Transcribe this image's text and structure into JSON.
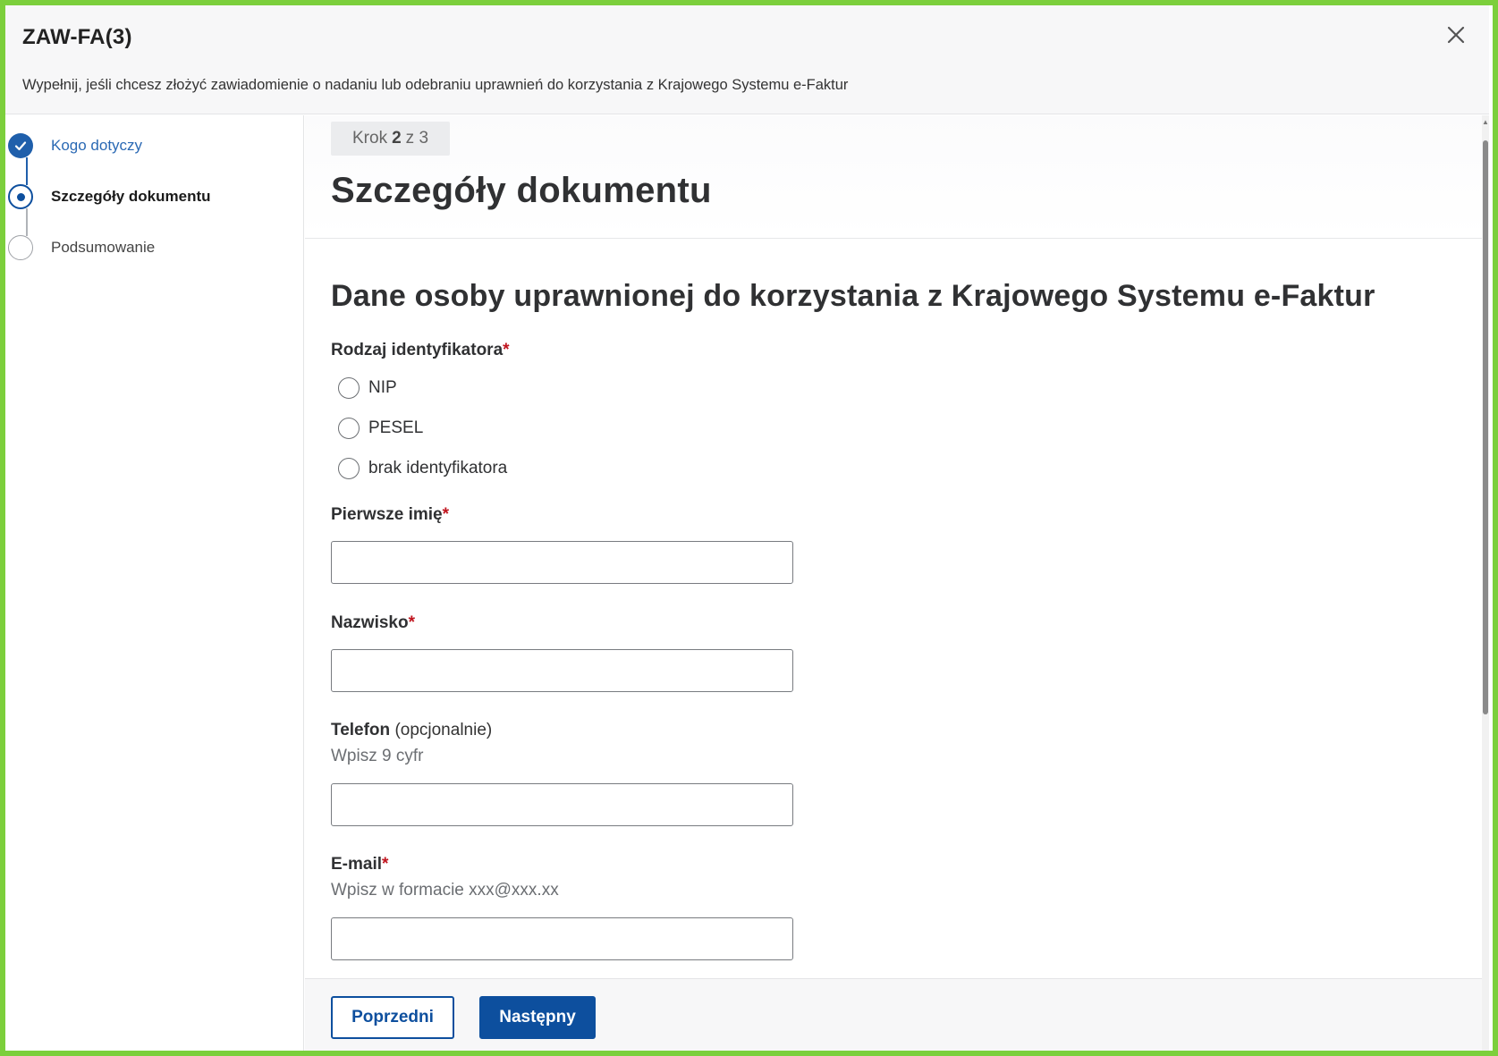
{
  "header": {
    "title": "ZAW-FA(3)",
    "subtitle": "Wypełnij, jeśli chcesz złożyć zawiadomienie o nadaniu lub odebraniu uprawnień do korzystania z Krajowego Systemu e-Faktur",
    "close_icon": "close-icon"
  },
  "steps": [
    {
      "label": "Kogo dotyczy",
      "state": "completed"
    },
    {
      "label": "Szczegóły dokumentu",
      "state": "current"
    },
    {
      "label": "Podsumowanie",
      "state": "pending"
    }
  ],
  "step_indicator": {
    "prefix": "Krok",
    "current": "2",
    "separator": "z",
    "total": "3"
  },
  "page_title": "Szczegóły dokumentu",
  "section_title": "Dane osoby uprawnionej do korzystania z Krajowego Systemu e-Faktur",
  "form": {
    "identifier_type": {
      "label": "Rodzaj identyfikatora",
      "required_mark": "*",
      "options": [
        "NIP",
        "PESEL",
        "brak identyfikatora"
      ]
    },
    "first_name": {
      "label": "Pierwsze imię",
      "required_mark": "*",
      "value": ""
    },
    "last_name": {
      "label": "Nazwisko",
      "required_mark": "*",
      "value": ""
    },
    "phone": {
      "label": "Telefon",
      "optional": "(opcjonalnie)",
      "hint": "Wpisz 9 cyfr",
      "value": ""
    },
    "email": {
      "label": "E-mail",
      "required_mark": "*",
      "hint": "Wpisz w formacie xxx@xxx.xx",
      "value": ""
    }
  },
  "footer": {
    "prev_label": "Poprzedni",
    "next_label": "Następny"
  },
  "colors": {
    "accent": "#0d4f9e",
    "required": "#c0141e",
    "frame": "#7ccf3c"
  }
}
